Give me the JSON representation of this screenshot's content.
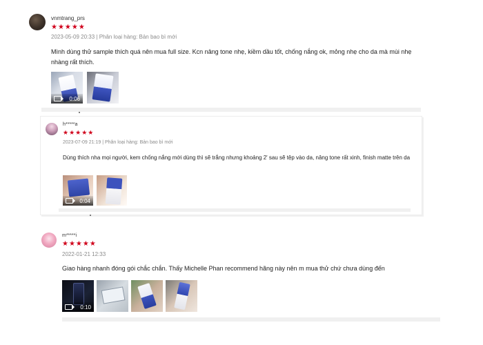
{
  "reviews": [
    {
      "username": "vnmtrang_prs",
      "rating": 5,
      "stars": "★★★★★",
      "meta": "2023-05-09 20:33 | Phân loại hàng: Bản bao bì mới",
      "text": "Mình dùng thử sample thích quá nên mua full size. Kcn nâng tone nhẹ, kiềm dầu tốt, chống nắng ok, mỏng nhẹ cho da mà mùi nhẹ nhàng rất thích.",
      "media": [
        {
          "type": "video",
          "icon": "video-camera-icon",
          "duration": "0:06"
        },
        {
          "type": "image"
        }
      ]
    },
    {
      "username": "h*****a",
      "rating": 5,
      "stars": "★★★★★",
      "meta": "2023-07-09 21:19 | Phân loại hàng: Bản bao bì mới",
      "text": "Dùng thích nha mọi người, kem chống nắng mới dùng thì sẽ trắng nhưng khoảng 2' sau sẽ tệp vào da, nâng tone rất xinh, finish matte trên da",
      "media": [
        {
          "type": "video",
          "icon": "video-camera-icon",
          "duration": "0:04"
        },
        {
          "type": "image"
        }
      ]
    },
    {
      "username": "m*****i",
      "rating": 5,
      "stars": "★★★★★",
      "meta": "2022-01-21 12:33",
      "text": "Giao hàng nhanh đóng gói chắc chắn. Thấy Michelle Phan recommend hãng này nên m mua thử chứ chưa dùng đến",
      "media": [
        {
          "type": "video",
          "icon": "video-camera-icon",
          "duration": "0:10"
        },
        {
          "type": "image"
        },
        {
          "type": "image"
        },
        {
          "type": "image"
        },
        {
          "type": "image"
        }
      ]
    }
  ],
  "colors": {
    "star": "#d0011b",
    "meta_text": "#8a8a8a",
    "divider": "#f0f0f0"
  }
}
